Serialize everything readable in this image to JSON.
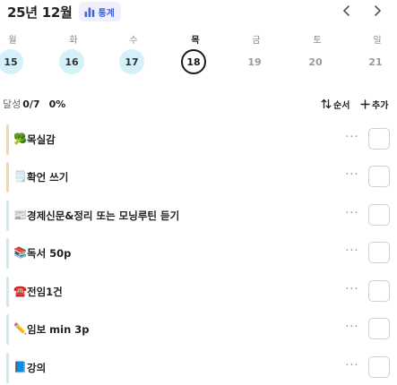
{
  "header": {
    "month_title": "25년 12월",
    "stats_label": "통계",
    "prev_icon": "chevron-left-icon",
    "next_icon": "chevron-right-icon"
  },
  "week": [
    {
      "dow": "월",
      "date": "15",
      "state": "done"
    },
    {
      "dow": "화",
      "date": "16",
      "state": "done"
    },
    {
      "dow": "수",
      "date": "17",
      "state": "done"
    },
    {
      "dow": "목",
      "date": "18",
      "state": "today"
    },
    {
      "dow": "금",
      "date": "19",
      "state": "future"
    },
    {
      "dow": "토",
      "date": "20",
      "state": "future"
    },
    {
      "dow": "일",
      "date": "21",
      "state": "future"
    }
  ],
  "summary": {
    "achieved_label": "달성",
    "achieved_count": "0/7",
    "achieved_pct": "0%",
    "order_label": "순서",
    "add_label": "추가"
  },
  "tasks": [
    {
      "icon": "🥦",
      "label": "목실감",
      "color": "#f8d7a6"
    },
    {
      "icon": "🗒️",
      "label": "확언 쓰기",
      "color": "#f8d7a6"
    },
    {
      "icon": "📰",
      "label": "경제신문&정리 또는 모닝루틴 듣기",
      "color": "#cfe9f2"
    },
    {
      "icon": "📚",
      "label": "독서 50p",
      "color": "#cfe9f2"
    },
    {
      "icon": "☎️",
      "label": "전임1건",
      "color": "#cfe9f2"
    },
    {
      "icon": "✏️",
      "label": "임보 min 3p",
      "color": "#cfe9f2"
    },
    {
      "icon": "📘",
      "label": "강의",
      "color": "#cfe9f2"
    }
  ],
  "more_label": "···",
  "colors": {
    "accent": "#4a63d6",
    "done_day": "#d3f1f9"
  }
}
